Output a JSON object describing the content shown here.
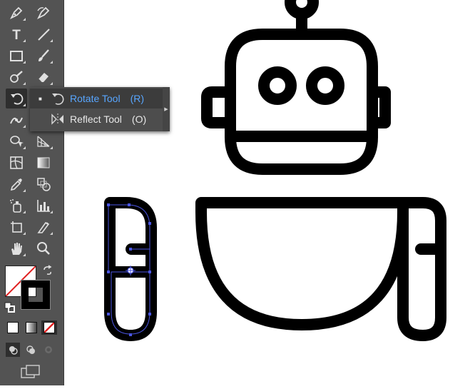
{
  "colors": {
    "toolbar_bg": "#535353",
    "flyout_bg": "#4d4d4d",
    "flyout_selected_text": "#58a6ff",
    "artwork_stroke": "#000000",
    "selection_path": "#4a55e0"
  },
  "toolbar": {
    "tools": [
      {
        "name": "pen-tool",
        "icon": "pen-icon"
      },
      {
        "name": "curvature-tool",
        "icon": "curvature-pen-icon"
      },
      {
        "name": "type-tool",
        "icon": "type-icon",
        "glyph": "T"
      },
      {
        "name": "line-segment-tool",
        "icon": "line-icon"
      },
      {
        "name": "rectangle-tool",
        "icon": "rectangle-icon"
      },
      {
        "name": "paintbrush-tool",
        "icon": "paintbrush-icon"
      },
      {
        "name": "shaper-tool",
        "icon": "shaper-icon"
      },
      {
        "name": "eraser-tool",
        "icon": "eraser-icon"
      },
      {
        "name": "rotate-tool",
        "icon": "rotate-icon"
      },
      {
        "name": "width-tool",
        "icon": "width-icon"
      },
      {
        "name": "shape-builder-tool",
        "icon": "shape-builder-icon"
      },
      {
        "name": "perspective-grid-tool",
        "icon": "perspective-grid-icon"
      },
      {
        "name": "mesh-tool",
        "icon": "mesh-icon"
      },
      {
        "name": "gradient-tool",
        "icon": "gradient-icon"
      },
      {
        "name": "eyedropper-tool",
        "icon": "eyedropper-icon"
      },
      {
        "name": "blend-tool",
        "icon": "blend-icon"
      },
      {
        "name": "symbol-sprayer-tool",
        "icon": "symbol-sprayer-icon"
      },
      {
        "name": "column-graph-tool",
        "icon": "column-graph-icon"
      },
      {
        "name": "artboard-tool",
        "icon": "artboard-icon"
      },
      {
        "name": "slice-tool",
        "icon": "slice-icon"
      },
      {
        "name": "hand-tool",
        "icon": "hand-icon"
      },
      {
        "name": "zoom-tool",
        "icon": "zoom-icon"
      }
    ]
  },
  "flyout": {
    "items": [
      {
        "label": "Rotate Tool",
        "shortcut": "(R)",
        "icon": "rotate-icon",
        "selected": true
      },
      {
        "label": "Reflect Tool",
        "shortcut": "(O)",
        "icon": "reflect-icon",
        "selected": false
      }
    ]
  }
}
